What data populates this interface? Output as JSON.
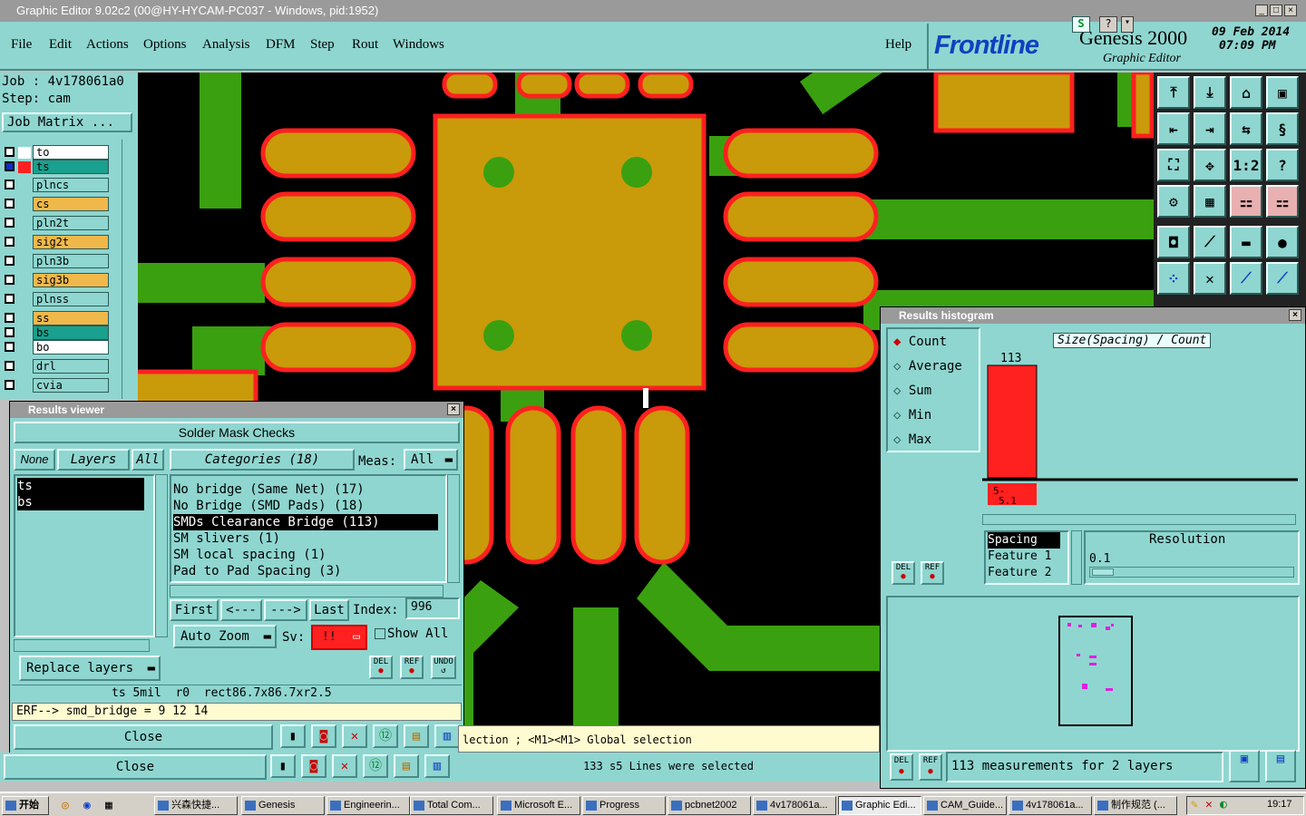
{
  "window": {
    "title": "Graphic Editor 9.02c2 (00@HY-HYCAM-PC037 - Windows, pid:1952)"
  },
  "menu": {
    "items": [
      "File",
      "Edit",
      "Actions",
      "Options",
      "Analysis",
      "DFM",
      "Step",
      "Rout",
      "Windows"
    ],
    "help": "Help"
  },
  "brand": {
    "logo": "Frontline",
    "product": "Genesis 2000",
    "subtitle": "Graphic Editor",
    "date": "09 Feb 2014",
    "time": "07:09 PM"
  },
  "job": {
    "job_label": "Job : 4v178061a0",
    "step_label": "Step: cam",
    "matrix_button": "Job Matrix ..."
  },
  "layers": [
    {
      "name": "to",
      "color": "#ffffff",
      "swatch": "#ffffff"
    },
    {
      "name": "ts",
      "color": "#1aa08e",
      "swatch": "#ff2020",
      "selected": true
    },
    {
      "name": "plncs",
      "color": "#8fd6d0",
      "swatch": "#8fd6d0"
    },
    {
      "name": "cs",
      "color": "#f0b84a",
      "swatch": "#8fd6d0"
    },
    {
      "name": "pln2t",
      "color": "#8fd6d0",
      "swatch": "#8fd6d0"
    },
    {
      "name": "sig2t",
      "color": "#f0b84a",
      "swatch": "#8fd6d0"
    },
    {
      "name": "pln3b",
      "color": "#8fd6d0",
      "swatch": "#8fd6d0"
    },
    {
      "name": "sig3b",
      "color": "#f0b84a",
      "swatch": "#8fd6d0"
    },
    {
      "name": "plnss",
      "color": "#8fd6d0",
      "swatch": "#8fd6d0"
    },
    {
      "name": "ss",
      "color": "#f0b84a",
      "swatch": "#8fd6d0"
    },
    {
      "name": "bs",
      "color": "#1aa08e",
      "swatch": "#8fd6d0"
    },
    {
      "name": "bo",
      "color": "#ffffff",
      "swatch": "#8fd6d0"
    },
    {
      "name": "drl",
      "color": "#8fd6d0",
      "swatch": "#8fd6d0"
    },
    {
      "name": "cvia",
      "color": "#8fd6d0",
      "swatch": "#8fd6d0"
    }
  ],
  "results_viewer": {
    "title": "Results viewer",
    "header": "Solder Mask Checks",
    "none_btn": "None",
    "layers_btn": "Layers",
    "all_btn": "All",
    "categories_btn": "Categories (18)",
    "meas_label": "Meas:",
    "meas_value": "All",
    "layer_list": [
      "ts",
      "bs"
    ],
    "categories": [
      "No bridge (Same Net) (17)",
      "No Bridge (SMD Pads) (18)",
      "SMDs Clearance Bridge (113)",
      "SM slivers (1)",
      "SM local spacing (1)",
      "Pad to Pad Spacing (3)"
    ],
    "selected_category_index": 2,
    "nav_first": "First",
    "nav_prev": "<---",
    "nav_next": "--->",
    "nav_last": "Last",
    "index_label": "Index:",
    "index_value": "996",
    "auto_zoom": "Auto Zoom",
    "sv_label": "Sv:",
    "sv_value": "!!",
    "show_all": "Show All",
    "replace_layers": "Replace layers",
    "del": "DEL",
    "ref": "REF",
    "undo": "UNDO",
    "info_line": "ts 5mil  r0  rect86.7x86.7xr2.5",
    "erf_line": "ERF--> smd_bridge = 9 12 14",
    "close": "Close"
  },
  "status": {
    "message": "lection ; <M1><M1> Global selection",
    "selected": "133 s5 Lines were selected",
    "close": "Close"
  },
  "histogram": {
    "title": "Results histogram",
    "options": [
      "Count",
      "Average",
      "Sum",
      "Min",
      "Max"
    ],
    "selected_option": "Count",
    "chart_title": "Size(Spacing) / Count",
    "del": "DEL",
    "ref": "REF",
    "attr_list": [
      "Spacing",
      "Feature 1",
      "Feature 2"
    ],
    "resolution_label": "Resolution",
    "resolution_value": "0.1",
    "summary": "113 measurements for 2 layers",
    "colors": {
      "bar": "#ff2020",
      "preview": "#e020e0"
    }
  },
  "chart_data": {
    "type": "bar",
    "title": "Size(Spacing) / Count",
    "categories": [
      "5-\n5.1"
    ],
    "values": [
      113
    ],
    "data_labels": [
      "113"
    ]
  },
  "taskbar": {
    "start": "开始",
    "tasks": [
      "兴森快捷...",
      "Genesis",
      "Engineerin...",
      "Total Com...",
      "Microsoft E...",
      "Progress",
      "pcbnet2002",
      "4v178061a...",
      "Graphic Edi...",
      "CAM_Guide...",
      "4v178061a...",
      "制作规范 (..."
    ],
    "clock": "19:17"
  }
}
